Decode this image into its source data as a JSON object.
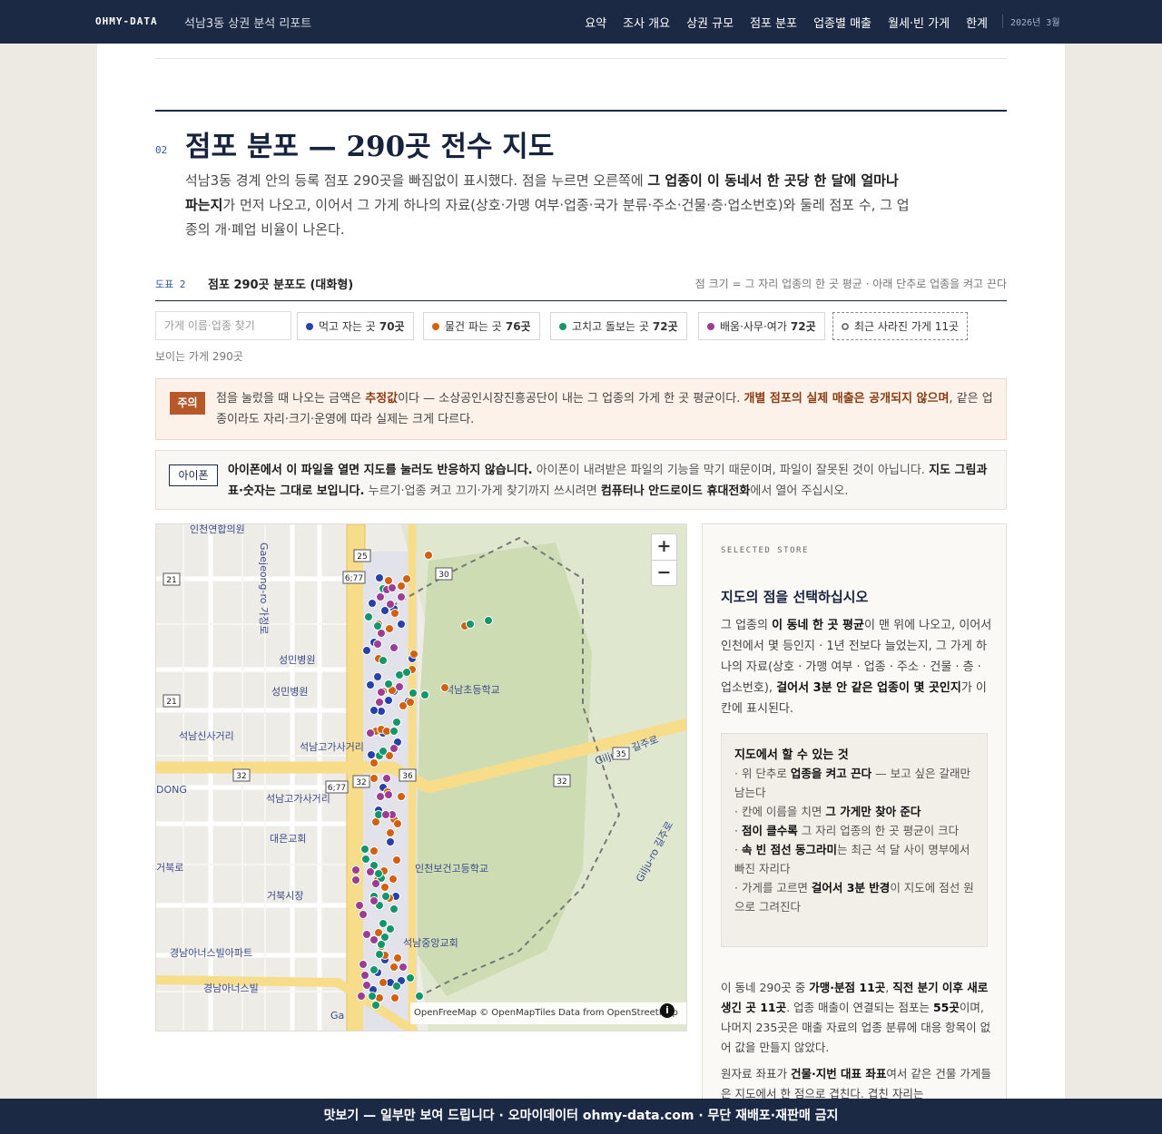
{
  "header": {
    "brand": "OHMY-DATA",
    "report_title": "석남3동 상권 분석 리포트",
    "nav": [
      "요약",
      "조사 개요",
      "상권 규모",
      "점포 분포",
      "업종별 매출",
      "월세·빈 가게",
      "한계"
    ],
    "date": "2026년 3월"
  },
  "section": {
    "number": "02",
    "title": "점포 분포 — 290곳 전수 지도",
    "intro": [
      "석남3동 경계 안의 등록 점포 290곳을 빠짐없이 표시했다. 점을 누르면 오른쪽에 ",
      "그 업종이 이 동네서 한 곳당 한 달에 얼마나 파는지",
      "가 먼저 나오고, 이어서 그 가게 하나의 자료(상호·가맹 여부·업종·국가 분류·주소·건물·층·업소번호)와 둘레 점포 수, 그 업종의 개·폐업 비율이 나온다."
    ]
  },
  "figure": {
    "number": "도표 2",
    "title": "점포 290곳 분포도 (대화형)",
    "note": "점 크기 = 그 자리 업종의 한 곳 평균 · 아래 단추로 업종을 켜고 끈다"
  },
  "filters": {
    "search_placeholder": "가게 이름·업종 찾기",
    "chips": [
      {
        "label": "먹고 자는 곳",
        "count": "70곳",
        "color": "#2741a8"
      },
      {
        "label": "물건 파는 곳",
        "count": "76곳",
        "color": "#d2600f"
      },
      {
        "label": "고치고 돌보는 곳",
        "count": "72곳",
        "color": "#14956a"
      },
      {
        "label": "배움·사무·여가",
        "count": "72곳",
        "color": "#9b3d92"
      }
    ],
    "closed_label": "최근 사라진 가게 11곳",
    "visible_count": "보이는 가게 290곳"
  },
  "warning": {
    "tag": "주의",
    "t1": "점을 눌렀을 때 나오는 금액은 ",
    "b1": "추정값",
    "t2": "이다 — 소상공인시장진흥공단이 내는 그 업종의 가게 한 곳 평균이다. ",
    "b2": "개별 점포의 실제 매출은 공개되지 않으며",
    "t3": ", 같은 업종이라도 자리·크기·운영에 따라 실제는 크게 다르다."
  },
  "iphone": {
    "tag": "아이폰",
    "b1": "아이폰에서 이 파일을 열면 지도를 눌러도 반응하지 않습니다.",
    "t1": " 아이폰이 내려받은 파일의 기능을 막기 때문이며, 파일이 잘못된 것이 아닙니다. ",
    "b2": "지도 그림과 표·숫자는 그대로 보입니다.",
    "t2": " 누르기·업종 켜고 끄기·가게 찾기까지 쓰시려면 ",
    "b3": "컴퓨터나 안드로이드 휴대전화",
    "t3": "에서 열어 주십시오."
  },
  "map": {
    "attribution": "OpenFreeMap © OpenMapTiles Data from OpenStreetMap",
    "labels": [
      "인천연합의원",
      "성민병원",
      "성민병원",
      "석남신사거리",
      "석남고가사거리",
      "석남고가사거리",
      "대은교회",
      "거북시장",
      "경남아너스빌아파트",
      "경남아너스빌",
      "석남초등학교",
      "인천보건고등학교",
      "석남중앙교회",
      "Gaejeong-ro 가정로",
      "Gilju-ro 길주로",
      "Gilju-ro 길주로",
      "거북로",
      "DONG",
      "Ga"
    ],
    "shields": [
      "25",
      "6;77",
      "21",
      "21",
      "32",
      "32",
      "36",
      "32",
      "35",
      "6;77",
      "30"
    ],
    "zoom_in": "+",
    "zoom_out": "−",
    "info": "i"
  },
  "panel": {
    "label": "SELECTED STORE",
    "title": "지도의 점을 선택하십시오",
    "d1": "그 업종의 ",
    "db1": "이 동네 한 곳 평균",
    "d2": "이 맨 위에 나오고, 이어서 인천에서 몇 등인지 · 1년 전보다 늘었는지, 그 가게 하나의 자료(상호 · 가맹 여부 · 업종 · 주소 · 건물 · 층 · 업소번호), ",
    "db2": "걸어서 3분 안 같은 업종이 몇 곳인지",
    "d3": "가 이 칸에 표시된다.",
    "box_title": "지도에서 할 수 있는 것",
    "tips": [
      {
        "pre": "· 위 단추로 ",
        "b": "업종을 켜고 끈다",
        "post": " — 보고 싶은 갈래만 남는다"
      },
      {
        "pre": "· 칸에 이름을 치면 ",
        "b": "그 가게만 찾아 준다",
        "post": ""
      },
      {
        "pre": "· ",
        "b": "점이 클수록",
        "post": " 그 자리 업종의 한 곳 평균이 크다"
      },
      {
        "pre": "· ",
        "b": "속 빈 점선 동그라미",
        "post": "는 최근 석 달 사이 명부에서 빠진 자리다"
      },
      {
        "pre": "· 가게를 고르면 ",
        "b": "걸어서 3분 반경",
        "post": "이 지도에 점선 원으로 그려진다"
      }
    ],
    "s1": "이 동네 290곳 중 ",
    "sb1": "가맹·분점 11곳",
    "s2": ", ",
    "sb2": "직전 분기 이후 새로 생긴 곳 11곳",
    "s3": ". 업종 매출이 연결되는 점포는 ",
    "sb3": "55곳",
    "s4": "이며, 나머지 235곳은 매출 자료의 업종 분류에 대응 항목이 없어 값을 만들지 않았다.",
    "r1": "원자료 좌표가 ",
    "rb1": "건물·지번 대표 좌표",
    "r2": "여서 같은 건물 가게들은 지도에서 한 점으로 겹친다. 겹친 자리는"
  },
  "footer": "맛보기 — 일부만 보여 드립니다 · 오마이데이터 ohmy-data.com · 무단 재배포·재판매 금지",
  "chart_data": {
    "type": "scatter",
    "series": [
      {
        "name": "먹고 자는 곳",
        "color": "#2741a8",
        "points": [
          [
            246,
            59
          ],
          [
            238,
            87
          ],
          [
            262,
            93
          ],
          [
            232,
            139
          ],
          [
            252,
            95
          ],
          [
            270,
            110
          ],
          [
            240,
            130
          ],
          [
            282,
            148
          ],
          [
            236,
            177
          ],
          [
            244,
            168
          ],
          [
            256,
            194
          ],
          [
            248,
            206
          ],
          [
            262,
            184
          ],
          [
            278,
            195
          ],
          [
            240,
            205
          ],
          [
            250,
            230
          ],
          [
            266,
            240
          ],
          [
            237,
            254
          ],
          [
            250,
            290
          ],
          [
            245,
            315
          ],
          [
            258,
            350
          ],
          [
            264,
            410
          ],
          [
            258,
            505
          ],
          [
            239,
            513
          ],
          [
            244,
            494
          ],
          [
            252,
            480
          ],
          [
            270,
            503
          ]
        ]
      },
      {
        "name": "물건 파는 곳",
        "color": "#d2600f",
        "points": [
          [
            300,
            34
          ],
          [
            256,
            62
          ],
          [
            276,
            60
          ],
          [
            270,
            68
          ],
          [
            245,
            110
          ],
          [
            257,
            115
          ],
          [
            263,
            98
          ],
          [
            284,
            143
          ],
          [
            245,
            148
          ],
          [
            282,
            160
          ],
          [
            318,
            180
          ],
          [
            340,
            112
          ],
          [
            250,
            184
          ],
          [
            260,
            183
          ],
          [
            272,
            200
          ],
          [
            280,
            196
          ],
          [
            242,
            228
          ],
          [
            248,
            226
          ],
          [
            254,
            228
          ],
          [
            257,
            255
          ],
          [
            240,
            263
          ],
          [
            262,
            325
          ],
          [
            266,
            330
          ],
          [
            258,
            340
          ],
          [
            242,
            328
          ],
          [
            251,
            382
          ],
          [
            244,
            392
          ],
          [
            252,
            400
          ],
          [
            261,
            391
          ],
          [
            257,
            412
          ],
          [
            245,
            450
          ],
          [
            248,
            465
          ],
          [
            252,
            475
          ],
          [
            262,
            488
          ],
          [
            266,
            478
          ],
          [
            250,
            505
          ],
          [
            246,
            522
          ],
          [
            263,
            522
          ],
          [
            240,
            280
          ],
          [
            255,
            295
          ],
          [
            270,
            300
          ],
          [
            240,
            360
          ],
          [
            265,
            370
          ]
        ]
      },
      {
        "name": "고치고 돌보는 곳",
        "color": "#14956a",
        "points": [
          [
            250,
            71
          ],
          [
            234,
            102
          ],
          [
            244,
            112
          ],
          [
            250,
            150
          ],
          [
            268,
            166
          ],
          [
            276,
            163
          ],
          [
            256,
            176
          ],
          [
            283,
            186
          ],
          [
            296,
            188
          ],
          [
            346,
            110
          ],
          [
            366,
            106
          ],
          [
            265,
            218
          ],
          [
            262,
            228
          ],
          [
            246,
            255
          ],
          [
            245,
            320
          ],
          [
            230,
            358
          ],
          [
            231,
            369
          ],
          [
            240,
            376
          ],
          [
            248,
            390
          ],
          [
            253,
            410
          ],
          [
            240,
            410
          ],
          [
            246,
            420
          ],
          [
            250,
            440
          ],
          [
            262,
            424
          ],
          [
            258,
            446
          ],
          [
            252,
            455
          ],
          [
            248,
            463
          ],
          [
            246,
            474
          ],
          [
            240,
            491
          ],
          [
            280,
            500
          ],
          [
            242,
            530
          ],
          [
            238,
            520
          ],
          [
            265,
            509
          ],
          [
            290,
            520
          ],
          [
            245,
            385
          ],
          [
            250,
            250
          ]
        ]
      },
      {
        "name": "배움·사무·여가",
        "color": "#9b3d92",
        "points": [
          [
            247,
            80
          ],
          [
            254,
            72
          ],
          [
            260,
            70
          ],
          [
            270,
            80
          ],
          [
            258,
            88
          ],
          [
            248,
            120
          ],
          [
            244,
            132
          ],
          [
            262,
            136
          ],
          [
            268,
            179
          ],
          [
            248,
            185
          ],
          [
            246,
            196
          ],
          [
            236,
            230
          ],
          [
            262,
            247
          ],
          [
            254,
            280
          ],
          [
            256,
            298
          ],
          [
            260,
            320
          ],
          [
            220,
            381
          ],
          [
            220,
            392
          ],
          [
            236,
            383
          ],
          [
            242,
            396
          ],
          [
            240,
            415
          ],
          [
            224,
            420
          ],
          [
            228,
            430
          ],
          [
            232,
            452
          ],
          [
            240,
            458
          ],
          [
            230,
            497
          ],
          [
            232,
            508
          ],
          [
            226,
            520
          ],
          [
            228,
            485
          ],
          [
            272,
            488
          ],
          [
            253,
            320
          ],
          [
            247,
            300
          ]
        ]
      }
    ]
  }
}
